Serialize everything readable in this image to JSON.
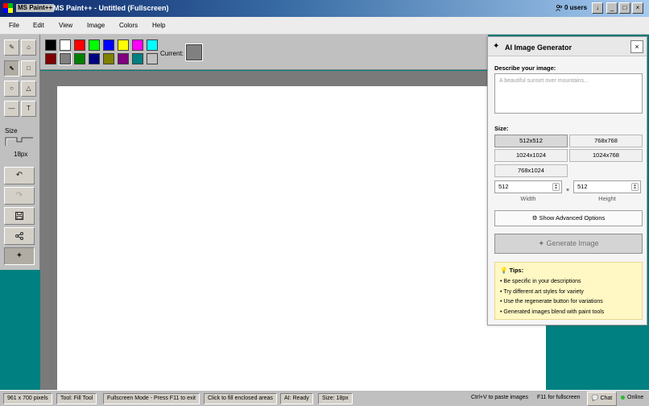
{
  "titlebar": {
    "app_name": "MS Paint++",
    "title": "MS Paint++ - Untitled (Fullscreen)",
    "users": "0 users",
    "buttons": [
      "↓",
      "_",
      "□",
      "×"
    ]
  },
  "menu": [
    "File",
    "Edit",
    "View",
    "Image",
    "Colors",
    "Help"
  ],
  "toolbox": {
    "tools": [
      "pencil",
      "eraser",
      "fill",
      "rectangle",
      "ellipse",
      "triangle",
      "line",
      "text"
    ],
    "tool_glyphs": [
      "✎",
      "⌂",
      "⬉",
      "□",
      "○",
      "△",
      "—",
      "T"
    ],
    "active_tool": "fill",
    "size_label": "Size",
    "size_value": "18px",
    "actions": [
      "undo",
      "redo",
      "save",
      "share",
      "ai-generate"
    ],
    "action_glyphs": [
      "↶",
      "↷",
      "💾",
      "⋯",
      "✦"
    ]
  },
  "palette": {
    "colors_row1": [
      "#000000",
      "#ffffff",
      "#ff0000",
      "#00ff00",
      "#0000ff",
      "#ffff00",
      "#ff00ff",
      "#00ffff"
    ],
    "colors_row2": [
      "#800000",
      "#808080",
      "#008000",
      "#000080",
      "#808000",
      "#800080",
      "#008080",
      "#c0c0c0"
    ],
    "current_label": "Current:",
    "current_color": "#808080"
  },
  "ai_panel": {
    "title": "AI Image Generator",
    "close": "×",
    "describe_label": "Describe your image:",
    "prompt_placeholder": "A beautiful sunset over mountains...",
    "size_label": "Size:",
    "sizes": [
      "512x512",
      "768x768",
      "1024x1024",
      "1024x768",
      "768x1024"
    ],
    "selected_size": "512x512",
    "width_value": "512",
    "height_value": "512",
    "width_label": "Width",
    "height_label": "Height",
    "times": "×",
    "advanced_button": "Show Advanced Options",
    "generate_button": "Generate Image",
    "tips_title": "Tips:",
    "tips": [
      "• Be specific in your descriptions",
      "• Try different art styles for variety",
      "• Use the regenerate button for variations",
      "• Generated images blend with paint tools"
    ]
  },
  "status": {
    "canvas_size": "961 x 700 pixels",
    "tool": "Tool: Fill Tool",
    "mode": "Fullscreen Mode - Press F11 to exit",
    "hint": "Click to fill enclosed areas",
    "ai": "AI: Ready",
    "size": "Size: 18px",
    "paste_hint": "Ctrl+V to paste images",
    "fullscreen_hint": "F11 for fullscreen",
    "chat": "Chat",
    "online": "Online"
  }
}
